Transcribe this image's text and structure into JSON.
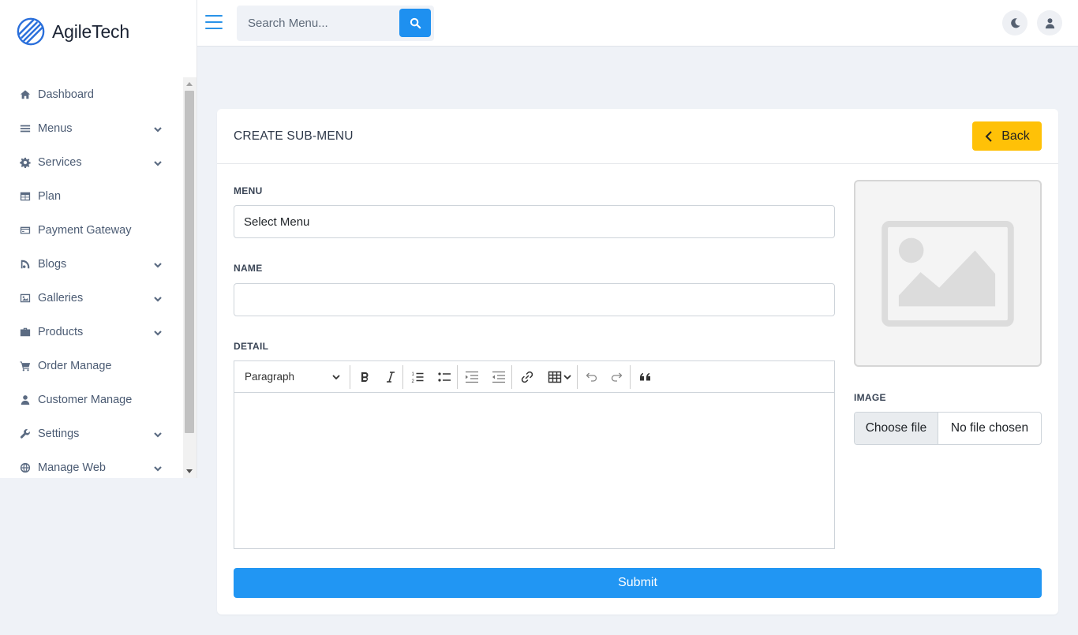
{
  "brand": {
    "name": "AgileTech"
  },
  "search": {
    "placeholder": "Search Menu..."
  },
  "sidebar": {
    "items": [
      {
        "label": "Dashboard",
        "icon": "home-icon",
        "expandable": false
      },
      {
        "label": "Menus",
        "icon": "bars-icon",
        "expandable": true
      },
      {
        "label": "Services",
        "icon": "cog-icon",
        "expandable": true
      },
      {
        "label": "Plan",
        "icon": "table-icon",
        "expandable": false
      },
      {
        "label": "Payment Gateway",
        "icon": "credit-card-icon",
        "expandable": false
      },
      {
        "label": "Blogs",
        "icon": "blog-icon",
        "expandable": true
      },
      {
        "label": "Galleries",
        "icon": "image-icon",
        "expandable": true
      },
      {
        "label": "Products",
        "icon": "briefcase-icon",
        "expandable": true
      },
      {
        "label": "Order Manage",
        "icon": "cart-icon",
        "expandable": false
      },
      {
        "label": "Customer Manage",
        "icon": "user-icon",
        "expandable": false
      },
      {
        "label": "Settings",
        "icon": "wrench-icon",
        "expandable": true
      },
      {
        "label": "Manage Web",
        "icon": "globe-icon",
        "expandable": true
      }
    ]
  },
  "page": {
    "title": "CREATE SUB-MENU",
    "back_label": "Back"
  },
  "form": {
    "menu_label": "MENU",
    "menu_value": "Select Menu",
    "name_label": "NAME",
    "name_value": "",
    "detail_label": "DETAIL",
    "paragraph_option": "Paragraph",
    "image_label": "IMAGE",
    "file_button": "Choose file",
    "file_status": "No file chosen",
    "submit_label": "Submit"
  },
  "colors": {
    "accent": "#2196f3",
    "back_button": "#ffc107"
  }
}
